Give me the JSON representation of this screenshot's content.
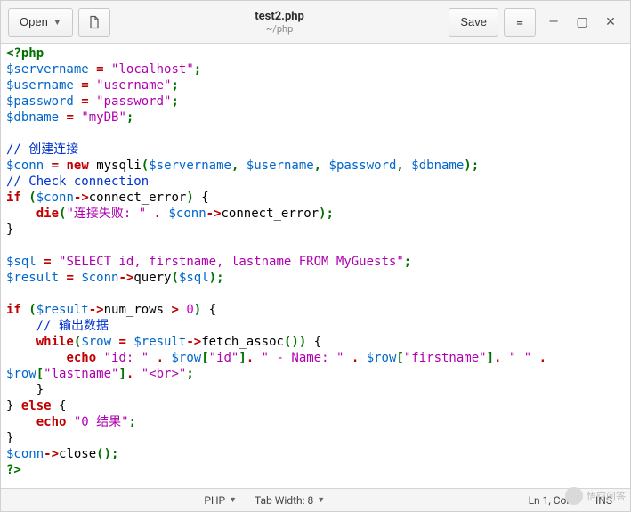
{
  "toolbar": {
    "open_label": "Open",
    "save_label": "Save"
  },
  "title": {
    "filename": "test2.php",
    "path": "~/php"
  },
  "statusbar": {
    "lang": "PHP",
    "tabwidth": "Tab Width: 8",
    "position": "Ln 1, Col 1",
    "mode": "INS"
  },
  "code": {
    "php_open": "<?php",
    "php_close": "?>",
    "servername_var": "$servername",
    "servername_val": "\"localhost\"",
    "username_var": "$username",
    "username_val": "\"username\"",
    "password_var": "$password",
    "password_val": "\"password\"",
    "dbname_var": "$dbname",
    "dbname_val": "\"myDB\"",
    "cmt_create": "// 创建连接",
    "conn_var": "$conn",
    "new_kw": "new",
    "mysqli": "mysqli",
    "cmt_check": "// Check connection",
    "if_kw": "if",
    "else_kw": "else",
    "while_kw": "while",
    "connect_error": "connect_error",
    "die": "die",
    "die_msg": "\"连接失败: \"",
    "sql_var": "$sql",
    "sql_val": "\"SELECT id, firstname, lastname FROM MyGuests\"",
    "result_var": "$result",
    "query": "query",
    "num_rows": "num_rows",
    "zero": "0",
    "cmt_output": "// 输出数据",
    "row_var": "$row",
    "fetch_assoc": "fetch_assoc",
    "echo": "echo",
    "id_lbl": "\"id: \"",
    "id_key": "\"id\"",
    "name_lbl": "\" - Name: \"",
    "fn_key": "\"firstname\"",
    "ln_key": "\"lastname\"",
    "space_str": "\" \"",
    "br_str": "\"<br>\"",
    "zero_result": "\"0 结果\"",
    "close": "close",
    "arrow": "->",
    "gt": ">",
    "eq": "=",
    "dot": ".",
    "comma": ",",
    "semi": ";",
    "lparen": "(",
    "rparen": ")",
    "lbrace": "{",
    "rbrace": "}",
    "lbracket": "[",
    "rbracket": "]"
  },
  "watermark": "悟空问答"
}
